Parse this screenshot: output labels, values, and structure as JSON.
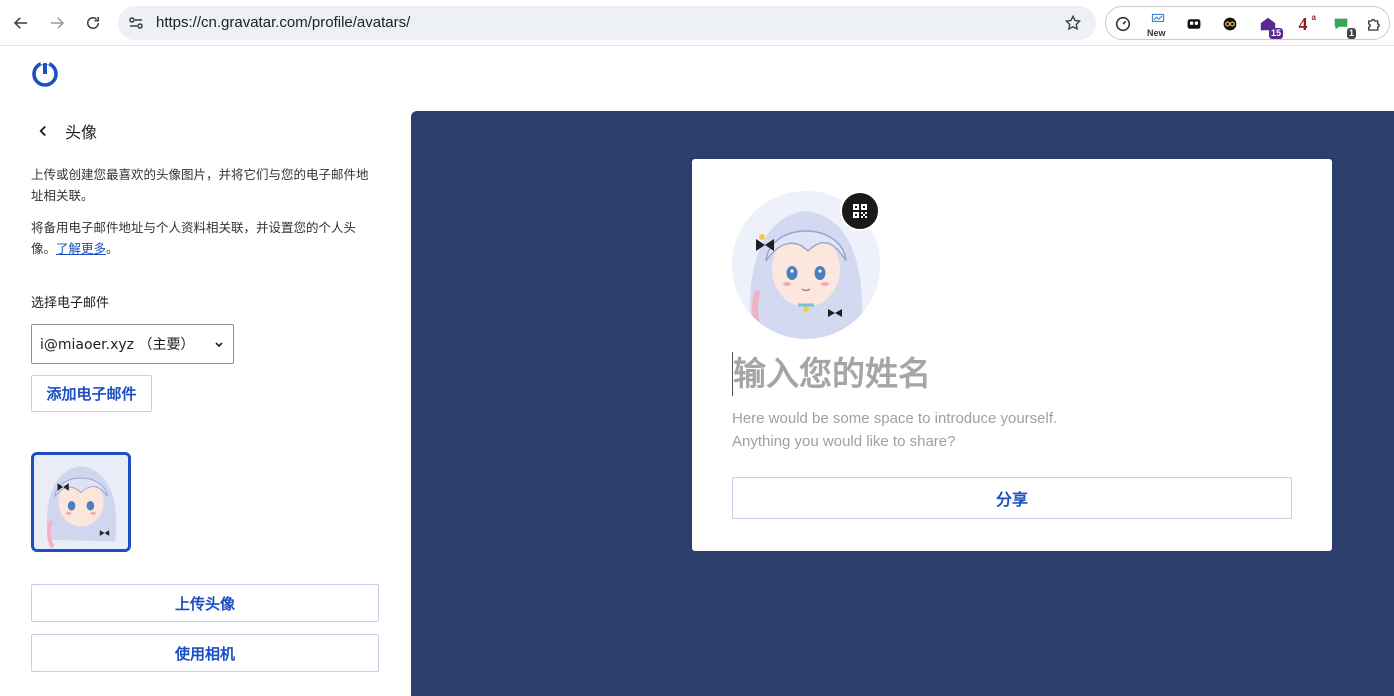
{
  "browser": {
    "url": "https://cn.gravatar.com/profile/avatars/",
    "extensions": [
      {
        "name": "speedometer-ext",
        "badge": ""
      },
      {
        "name": "new-ext",
        "badge": "New"
      },
      {
        "name": "two-squares-ext",
        "badge": ""
      },
      {
        "name": "infinity-ext",
        "badge": ""
      },
      {
        "name": "house-ext",
        "badge": "15"
      },
      {
        "name": "four-ext",
        "badge": "4"
      },
      {
        "name": "chat-ext",
        "badge": "1"
      },
      {
        "name": "puzzle-ext",
        "badge": ""
      }
    ]
  },
  "sidebar": {
    "title": "头像",
    "desc1": "上传或创建您最喜欢的头像图片，并将它们与您的电子邮件地址相关联。",
    "desc2_text": "将备用电子邮件地址与个人资料相关联，并设置您的个人头像。",
    "desc2_link": "了解更多",
    "desc2_end": "。",
    "email_label": "选择电子邮件",
    "email_selected": "i@miaoer.xyz （主要）",
    "add_email": "添加电子邮件",
    "upload": "上传头像",
    "camera": "使用相机"
  },
  "preview": {
    "name_placeholder": "输入您的姓名",
    "intro_line1": "Here would be some space to introduce yourself.",
    "intro_line2": "Anything you would like to share?",
    "share": "分享"
  },
  "colors": {
    "accent": "#1d4fc4",
    "preview_bg": "#2c3e6b"
  }
}
